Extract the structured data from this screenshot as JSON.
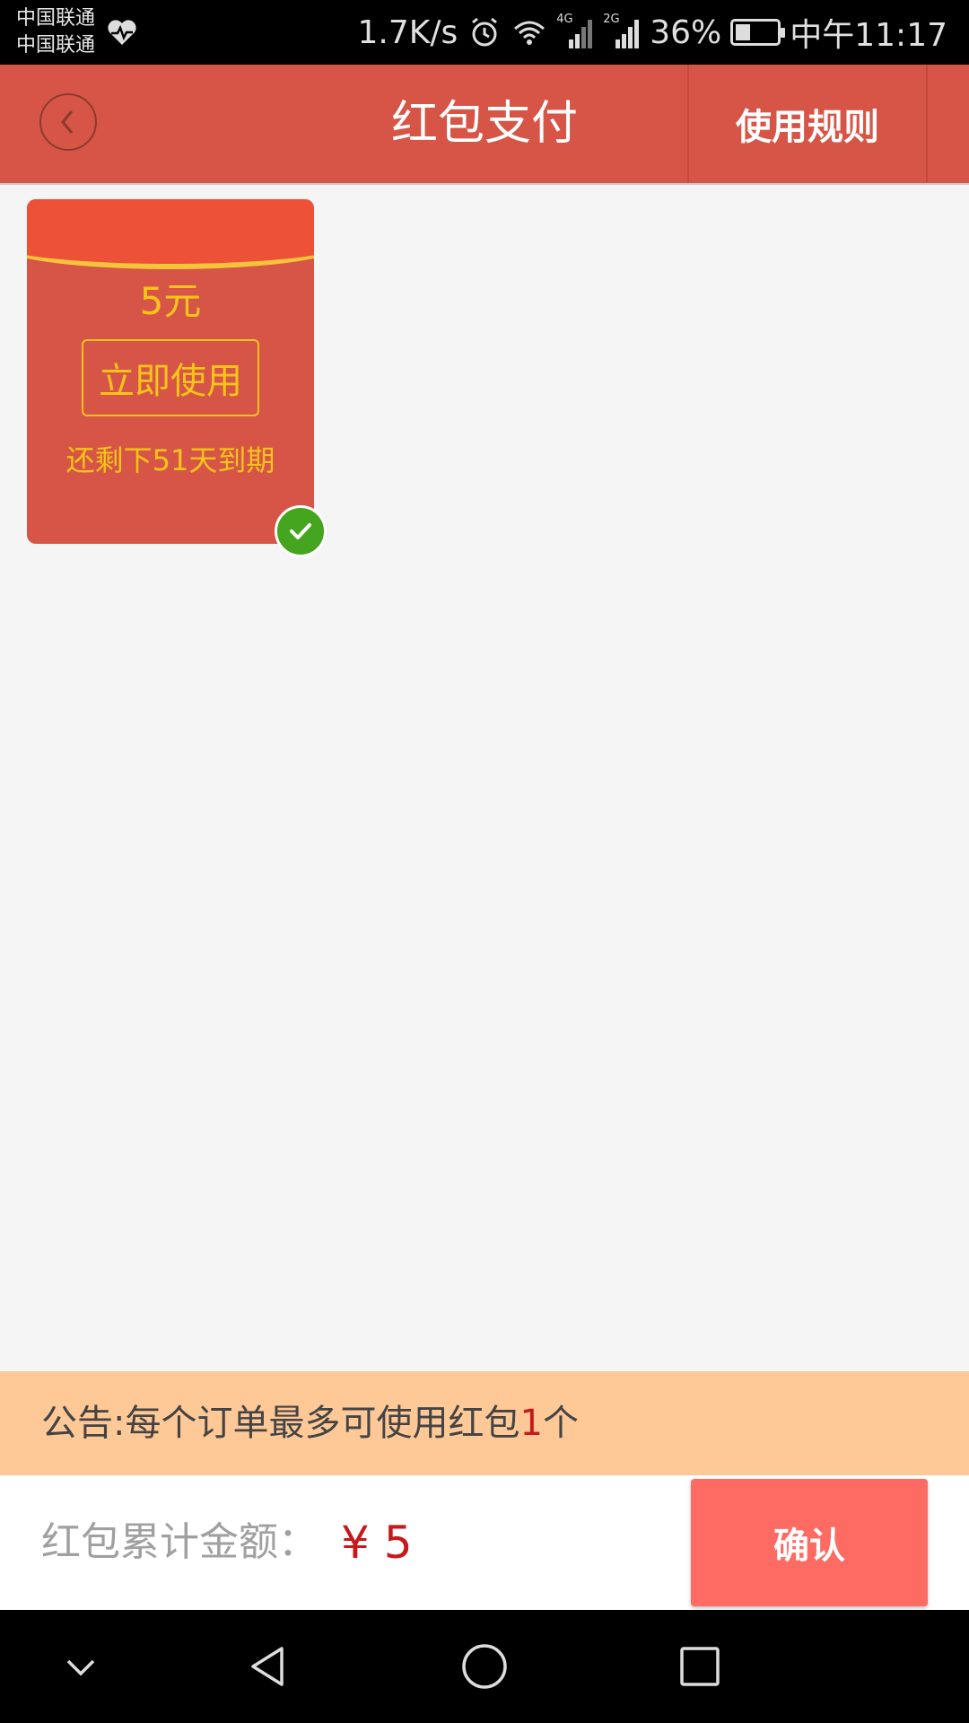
{
  "status_bar": {
    "carrier_1": "中国联通",
    "carrier_2": "中国联通",
    "speed": "1.7K/s",
    "network_1": "4G",
    "network_2": "2G",
    "battery": "36%",
    "battery_level": 0.36,
    "time": "中午11:17"
  },
  "header": {
    "title": "红包支付",
    "rules_label": "使用规则"
  },
  "packets": [
    {
      "amount": "5元",
      "use_label": "立即使用",
      "expire_text": "还剩下51天到期",
      "selected": true
    }
  ],
  "notice": {
    "prefix": "公告:每个订单最多可使用红包",
    "count": "1",
    "suffix": "个"
  },
  "footer": {
    "total_label": "红包累计金额：",
    "total_value": "¥ 5",
    "confirm_label": "确认"
  },
  "colors": {
    "header_bg": "#d65546",
    "packet_bg": "#d65546",
    "packet_text": "#f9c41a",
    "notice_bg": "#ffc997",
    "confirm_bg": "#fd6b62",
    "price_red": "#c8181b",
    "check_green": "#46a51e"
  }
}
